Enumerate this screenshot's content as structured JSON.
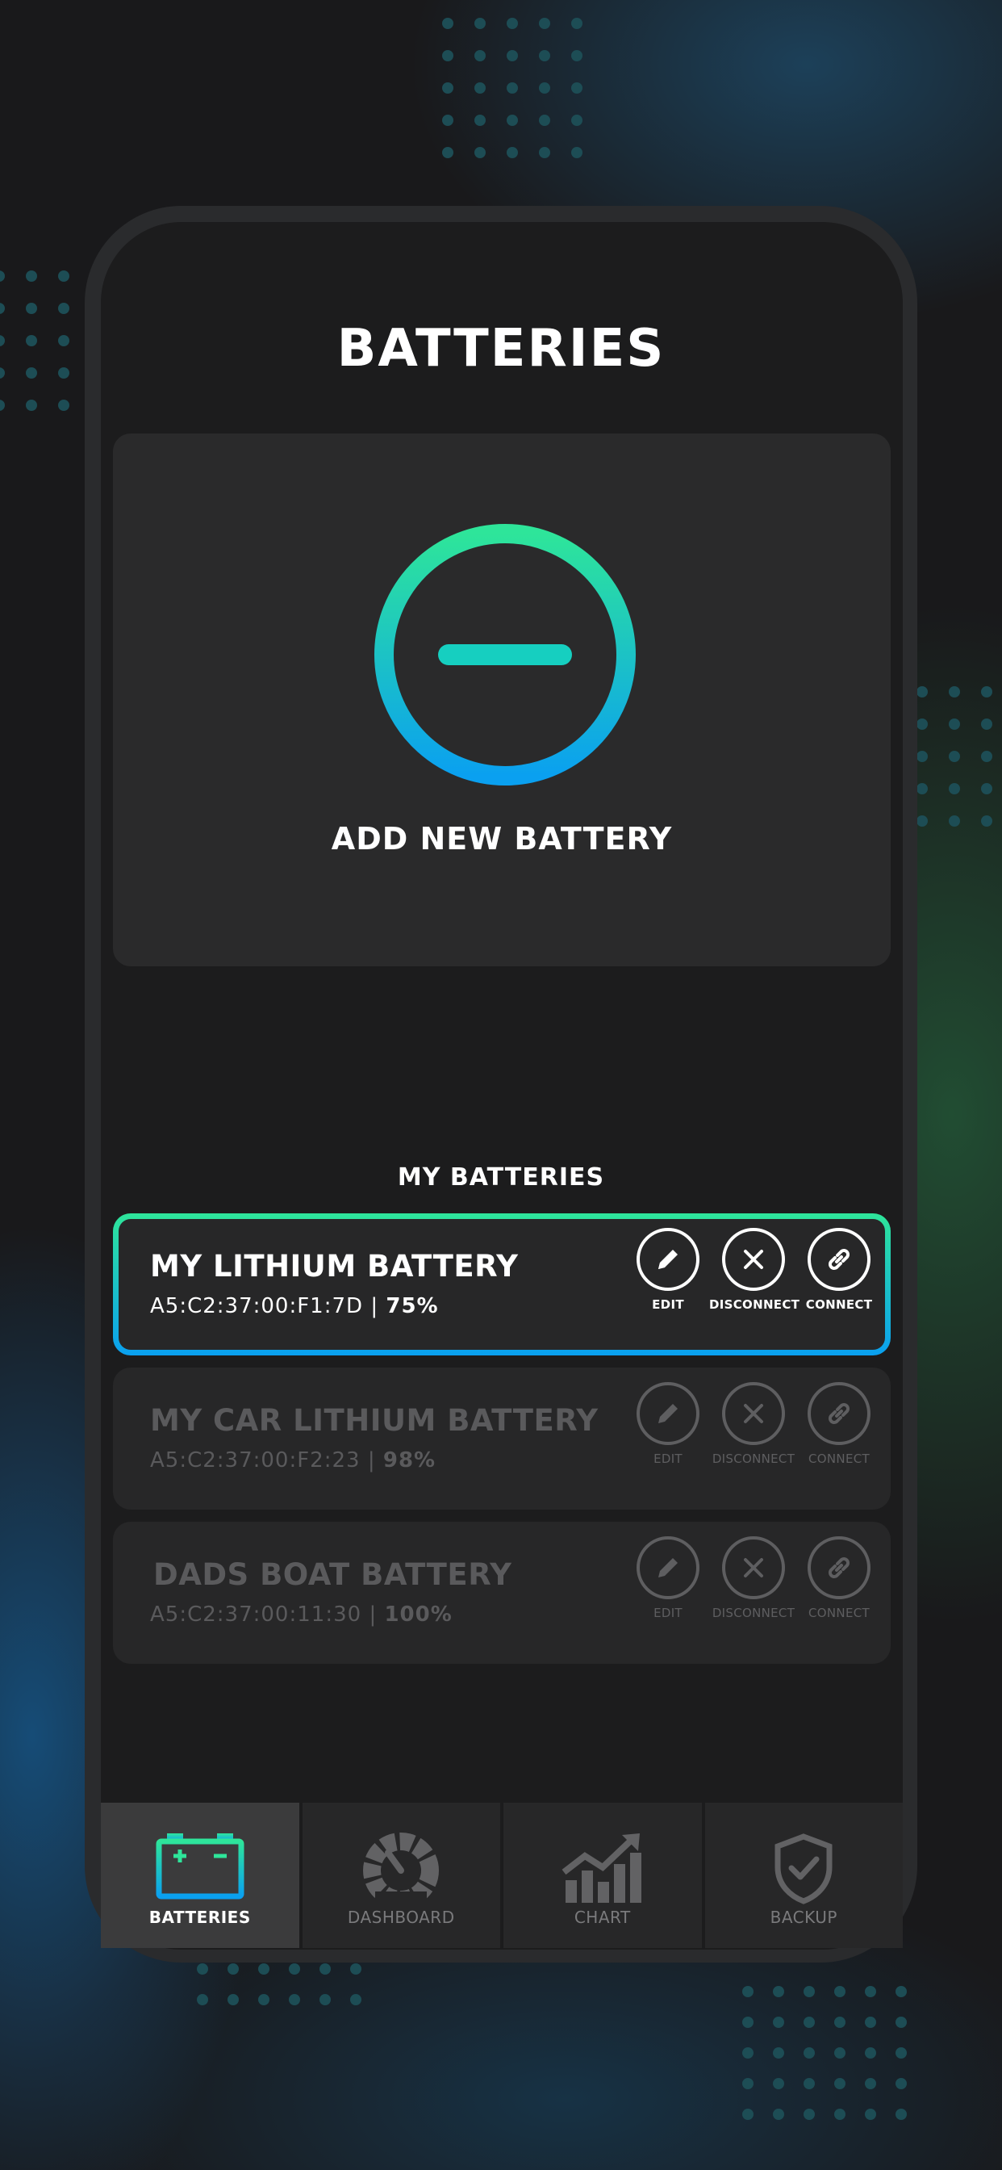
{
  "page": {
    "title": "BATTERIES"
  },
  "add_card": {
    "label": "ADD NEW BATTERY",
    "icon": "plus-circle-icon"
  },
  "section": {
    "label": "MY BATTERIES"
  },
  "colors": {
    "accent_green": "#2ee59a",
    "accent_blue": "#0aa0f0",
    "background": "#1c1c1d",
    "card": "#272728"
  },
  "batteries": [
    {
      "name": "MY LITHIUM BATTERY",
      "mac": "A5:C2:37:00:F1:7D",
      "separator": "|",
      "percent": "75%",
      "state": "connected"
    },
    {
      "name": "MY CAR LITHIUM BATTERY",
      "mac": "A5:C2:37:00:F2:23",
      "separator": "|",
      "percent": "98%",
      "state": "inactive"
    },
    {
      "name": "DADS BOAT BATTERY",
      "mac": "A5:C2:37:00:11:30",
      "separator": "|",
      "percent": "100%",
      "state": "inactive"
    }
  ],
  "actions": {
    "edit": "EDIT",
    "disconnect": "DISCONNECT",
    "connect": "CONNECT"
  },
  "nav": {
    "items": [
      {
        "label": "BATTERIES",
        "icon": "battery-icon",
        "active": true
      },
      {
        "label": "DASHBOARD",
        "icon": "gauge-icon",
        "active": false
      },
      {
        "label": "CHART",
        "icon": "chart-icon",
        "active": false
      },
      {
        "label": "BACKUP",
        "icon": "shield-check-icon",
        "active": false
      }
    ]
  }
}
